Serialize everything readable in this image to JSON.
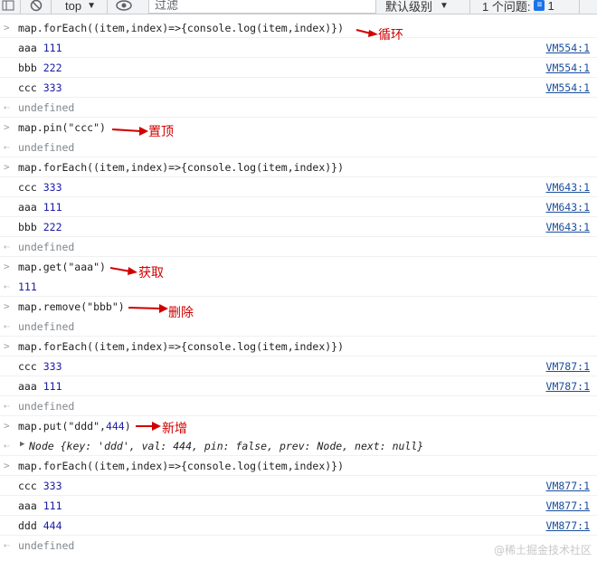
{
  "toolbar": {
    "context": "top",
    "filter_placeholder": "过滤",
    "levels": "默认级别",
    "issues": "1 个问题:",
    "issues_count": "1"
  },
  "console": {
    "l1": "map.forEach((item,index)=>{console.log(item,index)})",
    "o1": "aaa",
    "o1n": "111",
    "s1": "VM554:1",
    "o2": "bbb",
    "o2n": "222",
    "s2": "VM554:1",
    "o3": "ccc",
    "o3n": "333",
    "s3": "VM554:1",
    "u1": "undefined",
    "l2": "map.pin(\"ccc\")",
    "u2": "undefined",
    "l3": "map.forEach((item,index)=>{console.log(item,index)})",
    "o4": "ccc",
    "o4n": "333",
    "s4": "VM643:1",
    "o5": "aaa",
    "o5n": "111",
    "s5": "VM643:1",
    "o6": "bbb",
    "o6n": "222",
    "s6": "VM643:1",
    "u3": "undefined",
    "l4": "map.get(\"aaa\")",
    "r4": "111",
    "l5": "map.remove(\"bbb\")",
    "u5": "undefined",
    "l6": "map.forEach((item,index)=>{console.log(item,index)})",
    "o7": "ccc",
    "o7n": "333",
    "s7": "VM787:1",
    "o8": "aaa",
    "o8n": "111",
    "s8": "VM787:1",
    "u6": "undefined",
    "l7a": "map.put(\"ddd\",",
    "l7b": "444",
    "l7c": ")",
    "node_summary": "Node {key: 'ddd', val: 444, pin: false, prev: Node, next: null}",
    "l8": "map.forEach((item,index)=>{console.log(item,index)})",
    "o9": "ccc",
    "o9n": "333",
    "s9": "VM877:1",
    "o10": "aaa",
    "o10n": "111",
    "s10": "VM877:1",
    "o11": "ddd",
    "o11n": "444",
    "s11": "VM877:1",
    "u8": "undefined"
  },
  "annotations": {
    "loop": "循环",
    "pin": "置顶",
    "get": "获取",
    "remove": "删除",
    "add": "新增"
  },
  "watermark": "@稀土掘金技术社区",
  "colors": {
    "annotation": "#d00000",
    "link": "#1a4e9c",
    "number": "#1a1aa6",
    "string": "#c41a16"
  }
}
